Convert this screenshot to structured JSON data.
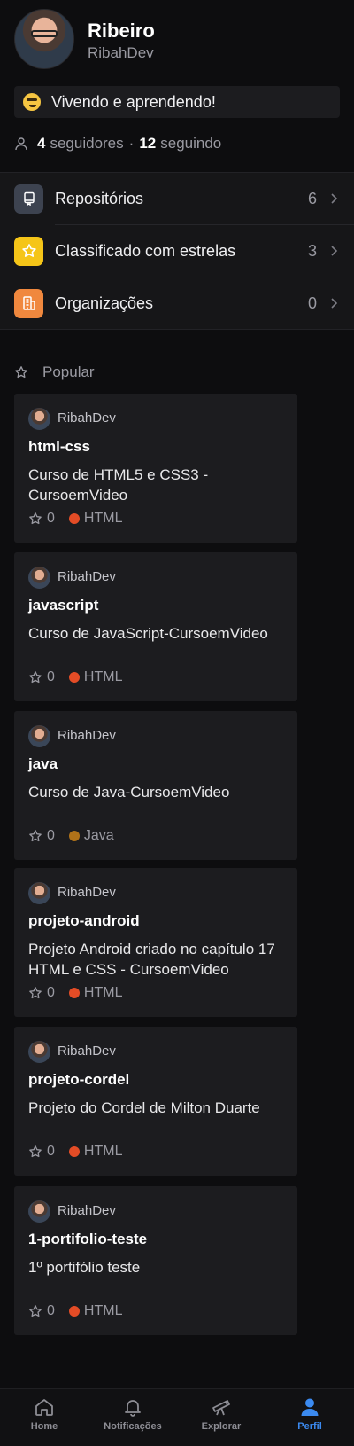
{
  "profile": {
    "name": "Ribeiro",
    "login": "RibahDev",
    "status_text": "Vivendo e aprendendo!",
    "followers_count": "4",
    "followers_label": "seguidores",
    "following_count": "12",
    "following_label": "seguindo"
  },
  "menu": [
    {
      "label": "Repositórios",
      "count": "6",
      "icon": "repo-icon",
      "color": "#3d4350"
    },
    {
      "label": "Classificado com estrelas",
      "count": "3",
      "icon": "star-icon",
      "color": "#f5c518"
    },
    {
      "label": "Organizações",
      "count": "0",
      "icon": "organization-icon",
      "color": "#f0883e"
    }
  ],
  "popular": {
    "heading": "Popular",
    "repos": [
      {
        "owner": "RibahDev",
        "name": "html-css",
        "description": "Curso de HTML5 e CSS3 - CursoemVideo",
        "stars": "0",
        "language": "HTML",
        "language_color": "#e34c26"
      },
      {
        "owner": "RibahDev",
        "name": "javascript",
        "description": "Curso de JavaScript-CursoemVideo",
        "stars": "0",
        "language": "HTML",
        "language_color": "#e34c26"
      },
      {
        "owner": "RibahDev",
        "name": "java",
        "description": "Curso de Java-CursoemVideo",
        "stars": "0",
        "language": "Java",
        "language_color": "#b07219"
      },
      {
        "owner": "RibahDev",
        "name": "projeto-android",
        "description": "Projeto Android criado no capítulo 17 HTML e CSS - CursoemVideo",
        "stars": "0",
        "language": "HTML",
        "language_color": "#e34c26"
      },
      {
        "owner": "RibahDev",
        "name": "projeto-cordel",
        "description": "Projeto do Cordel de Milton Duarte",
        "stars": "0",
        "language": "HTML",
        "language_color": "#e34c26"
      },
      {
        "owner": "RibahDev",
        "name": "1-portifolio-teste",
        "description": "1º portifólio teste",
        "stars": "0",
        "language": "HTML",
        "language_color": "#e34c26"
      }
    ]
  },
  "tabs": [
    {
      "label": "Home",
      "icon": "home-icon",
      "active": false
    },
    {
      "label": "Notificações",
      "icon": "bell-icon",
      "active": false
    },
    {
      "label": "Explorar",
      "icon": "telescope-icon",
      "active": false
    },
    {
      "label": "Perfil",
      "icon": "person-icon",
      "active": true
    }
  ],
  "colors": {
    "accent": "#3b8af0",
    "background": "#0d0d0f",
    "card": "#1c1c1f"
  }
}
